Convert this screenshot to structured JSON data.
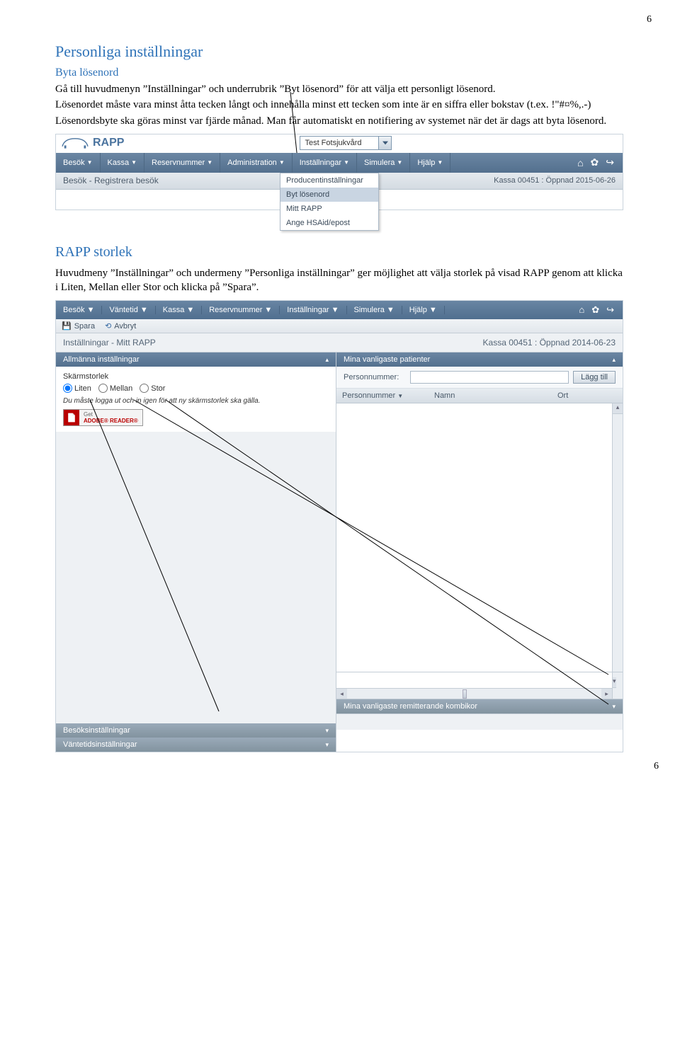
{
  "page": {
    "top_num": "6",
    "bottom_num": "6"
  },
  "sec1": {
    "heading": "Personliga inställningar",
    "sub": "Byta lösenord",
    "p1": "Gå till huvudmenyn ”Inställningar” och underrubrik ”Byt lösenord” för att välja ett personligt lösenord.",
    "p2": "Lösenordet måste vara minst åtta tecken långt och innehålla minst ett tecken som inte är en siffra eller bokstav (t.ex. !\"#¤%,.-)",
    "p3": "Lösenordsbyte ska göras minst var fjärde månad. Man får automatiskt en notifiering av systemet när det är dags att byta lösenord."
  },
  "sec2": {
    "heading": "RAPP storlek",
    "p1": "Huvudmeny ”Inställningar” och undermeny ”Personliga inställningar” ger möjlighet att välja storlek på visad RAPP genom att klicka i Liten, Mellan eller Stor och klicka på ”Spara”."
  },
  "shot1": {
    "rapp": "RAPP",
    "select_value": "Test Fotsjukvård",
    "menus": [
      "Besök",
      "Kassa",
      "Reservnummer",
      "Administration",
      "Inställningar",
      "Simulera",
      "Hjälp"
    ],
    "dropdown": [
      "Producentinställningar",
      "Byt lösenord",
      "Mitt RAPP",
      "Ange HSAid/epost"
    ],
    "highlight_idx": 1,
    "subbar_left": "Besök - Registrera besök",
    "subbar_right": "Kassa 00451 : Öppnad 2015-06-26"
  },
  "shot2": {
    "menus": [
      "Besök",
      "Väntetid",
      "Kassa",
      "Reservnummer",
      "Inställningar",
      "Simulera",
      "Hjälp"
    ],
    "toolbar": {
      "save": "Spara",
      "cancel": "Avbryt"
    },
    "title_left": "Inställningar - Mitt RAPP",
    "title_right": "Kassa 00451 : Öppnad 2014-06-23",
    "left": {
      "panel1": "Allmänna inställningar",
      "size_label": "Skärmstorlek",
      "radios": [
        "Liten",
        "Mellan",
        "Stor"
      ],
      "radio_selected": 0,
      "note": "Du måste logga ut och in igen för att ny skärmstorlek ska gälla.",
      "adobe_get": "Get",
      "adobe_reader": "ADOBE® READER®",
      "collapsed": [
        "Besöksinställningar",
        "Väntetidsinställningar"
      ]
    },
    "right": {
      "panel1": "Mina vanligaste patienter",
      "pnr_label": "Personnummer:",
      "add_btn": "Lägg till",
      "headers": [
        "Personnummer",
        "Namn",
        "Ort"
      ],
      "collapsed": [
        "Mina vanligaste remitterande kombikor"
      ]
    }
  }
}
